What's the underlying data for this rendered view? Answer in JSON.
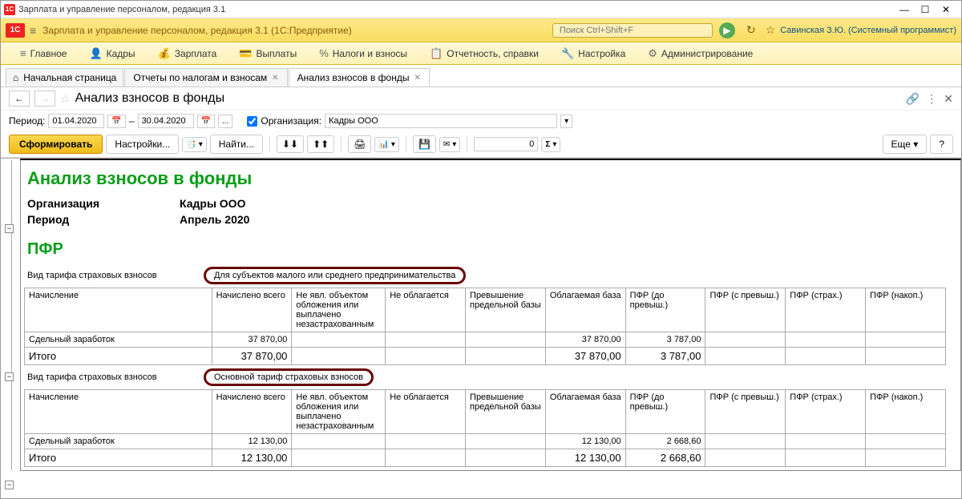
{
  "titlebar": {
    "text": "Зарплата и управление персоналом, редакция 3.1"
  },
  "header": {
    "title": "Зарплата и управление персоналом, редакция 3.1  (1С:Предприятие)",
    "search_placeholder": "Поиск Ctrl+Shift+F",
    "user": "Савинская З.Ю. (Системный программист)"
  },
  "menu": {
    "items": [
      {
        "icon": "≡",
        "label": "Главное"
      },
      {
        "icon": "👤",
        "label": "Кадры"
      },
      {
        "icon": "💰",
        "label": "Зарплата"
      },
      {
        "icon": "💳",
        "label": "Выплаты"
      },
      {
        "icon": "%",
        "label": "Налоги и взносы"
      },
      {
        "icon": "📋",
        "label": "Отчетность, справки"
      },
      {
        "icon": "🔧",
        "label": "Настройка"
      },
      {
        "icon": "⚙",
        "label": "Администрирование"
      }
    ]
  },
  "tabs": {
    "home": "Начальная страница",
    "items": [
      {
        "label": "Отчеты по налогам и взносам"
      },
      {
        "label": "Анализ взносов в фонды",
        "active": true
      }
    ]
  },
  "page": {
    "title": "Анализ взносов в фонды"
  },
  "filter": {
    "period_label": "Период:",
    "date_from": "01.04.2020",
    "date_sep": "–",
    "date_to": "30.04.2020",
    "org_label": "Организация:",
    "org_value": "Кадры ООО"
  },
  "actions": {
    "form": "Сформировать",
    "settings": "Настройки...",
    "find": "Найти...",
    "more": "Еще",
    "num": "0"
  },
  "report": {
    "title": "Анализ взносов в фонды",
    "org_label": "Организация",
    "org_value": "Кадры ООО",
    "period_label": "Период",
    "period_value": "Апрель 2020",
    "section": "ПФР",
    "tariff_label": "Вид тарифа страховых взносов",
    "tariff1": "Для субъектов малого или среднего предпринимательства",
    "tariff2": "Основной тариф страховых взносов",
    "headers": {
      "c1": "Начисление",
      "c2": "Начислено всего",
      "c3": "Не явл. объектом обложения или выплачено незастрахованным",
      "c4": "Не облагается",
      "c5": "Превышение предельной базы",
      "c6": "Облагаемая база",
      "c7": "ПФР (до превыш.)",
      "c8": "ПФР (с превыш.)",
      "c9": "ПФР (страх.)",
      "c10": "ПФР (накоп.)"
    },
    "row1": {
      "name": "Сдельный заработок",
      "total": "37 870,00",
      "base": "37 870,00",
      "pfr": "3 787,00"
    },
    "row1_total": {
      "name": "Итого",
      "total": "37 870,00",
      "base": "37 870,00",
      "pfr": "3 787,00"
    },
    "row2": {
      "name": "Сдельный заработок",
      "total": "12 130,00",
      "base": "12 130,00",
      "pfr": "2 668,60"
    },
    "row2_total": {
      "name": "Итого",
      "total": "12 130,00",
      "base": "12 130,00",
      "pfr": "2 668,60"
    }
  }
}
